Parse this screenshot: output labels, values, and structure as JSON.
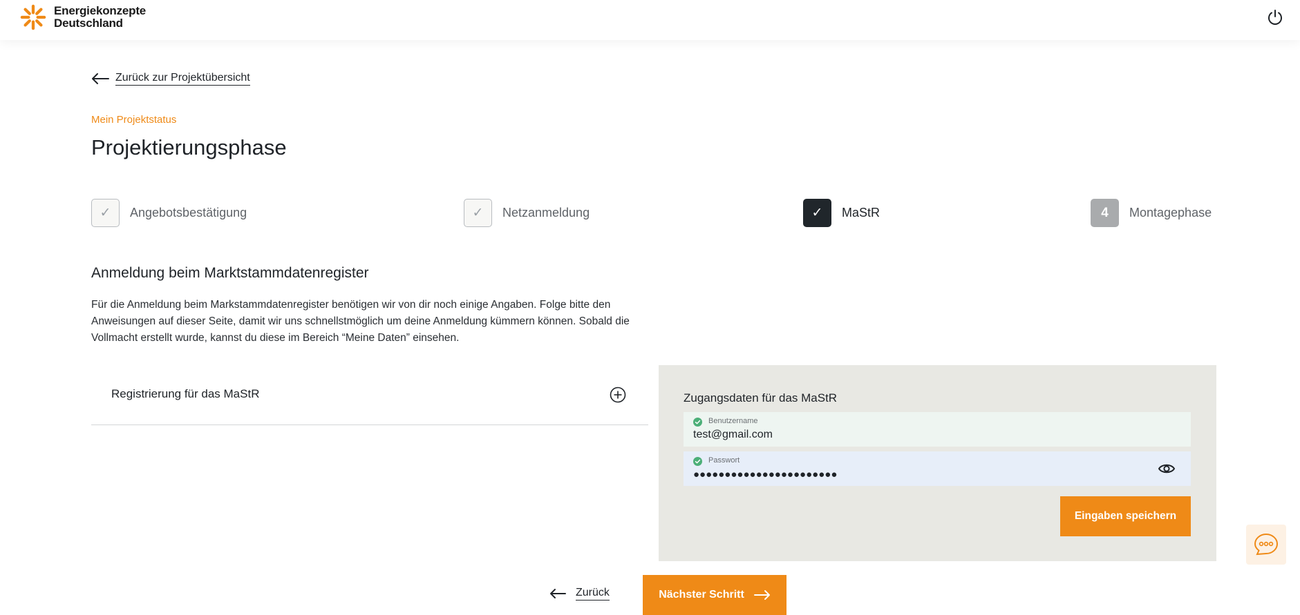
{
  "brand": {
    "line1": "Energiekonzepte",
    "line2": "Deutschland",
    "accent": "#ef8a17"
  },
  "header": {
    "logout_icon": "power-icon"
  },
  "nav": {
    "back_label": "Zurück zur Projektübersicht"
  },
  "status": {
    "eyebrow": "Mein Projektstatus",
    "title": "Projektierungsphase"
  },
  "steps": [
    {
      "label": "Angebotsbestätigung",
      "state": "done",
      "marker": "✓"
    },
    {
      "label": "Netzanmeldung",
      "state": "done",
      "marker": "✓"
    },
    {
      "label": "MaStR",
      "state": "active",
      "marker": "✓"
    },
    {
      "label": "Montagephase",
      "state": "todo",
      "marker": "4"
    }
  ],
  "section": {
    "title": "Anmeldung beim Marktstammdatenregister",
    "intro": "Für die Anmeldung beim Markstammdatenregister benötigen wir von dir noch einige Angaben. Folge bitte den Anweisungen auf dieser Seite, damit wir uns schnellstmöglich um deine Anmeldung kümmern können. Sobald die Vollmacht erstellt wurde, kannst du diese im Bereich “Meine Daten” einsehen."
  },
  "accordion": {
    "label": "Registrierung für das MaStR",
    "icon": "plus-circle-icon"
  },
  "credentials": {
    "title": "Zugangsdaten für das MaStR",
    "username": {
      "label": "Benutzername",
      "value": "test@gmail.com"
    },
    "password": {
      "label": "Passwort",
      "value": "●●●●●●●●●●●●●●●●●●●●●●●"
    },
    "save_label": "Eingaben speichern"
  },
  "footer": {
    "back_label": "Zurück",
    "next_label": "Nächster Schritt"
  }
}
